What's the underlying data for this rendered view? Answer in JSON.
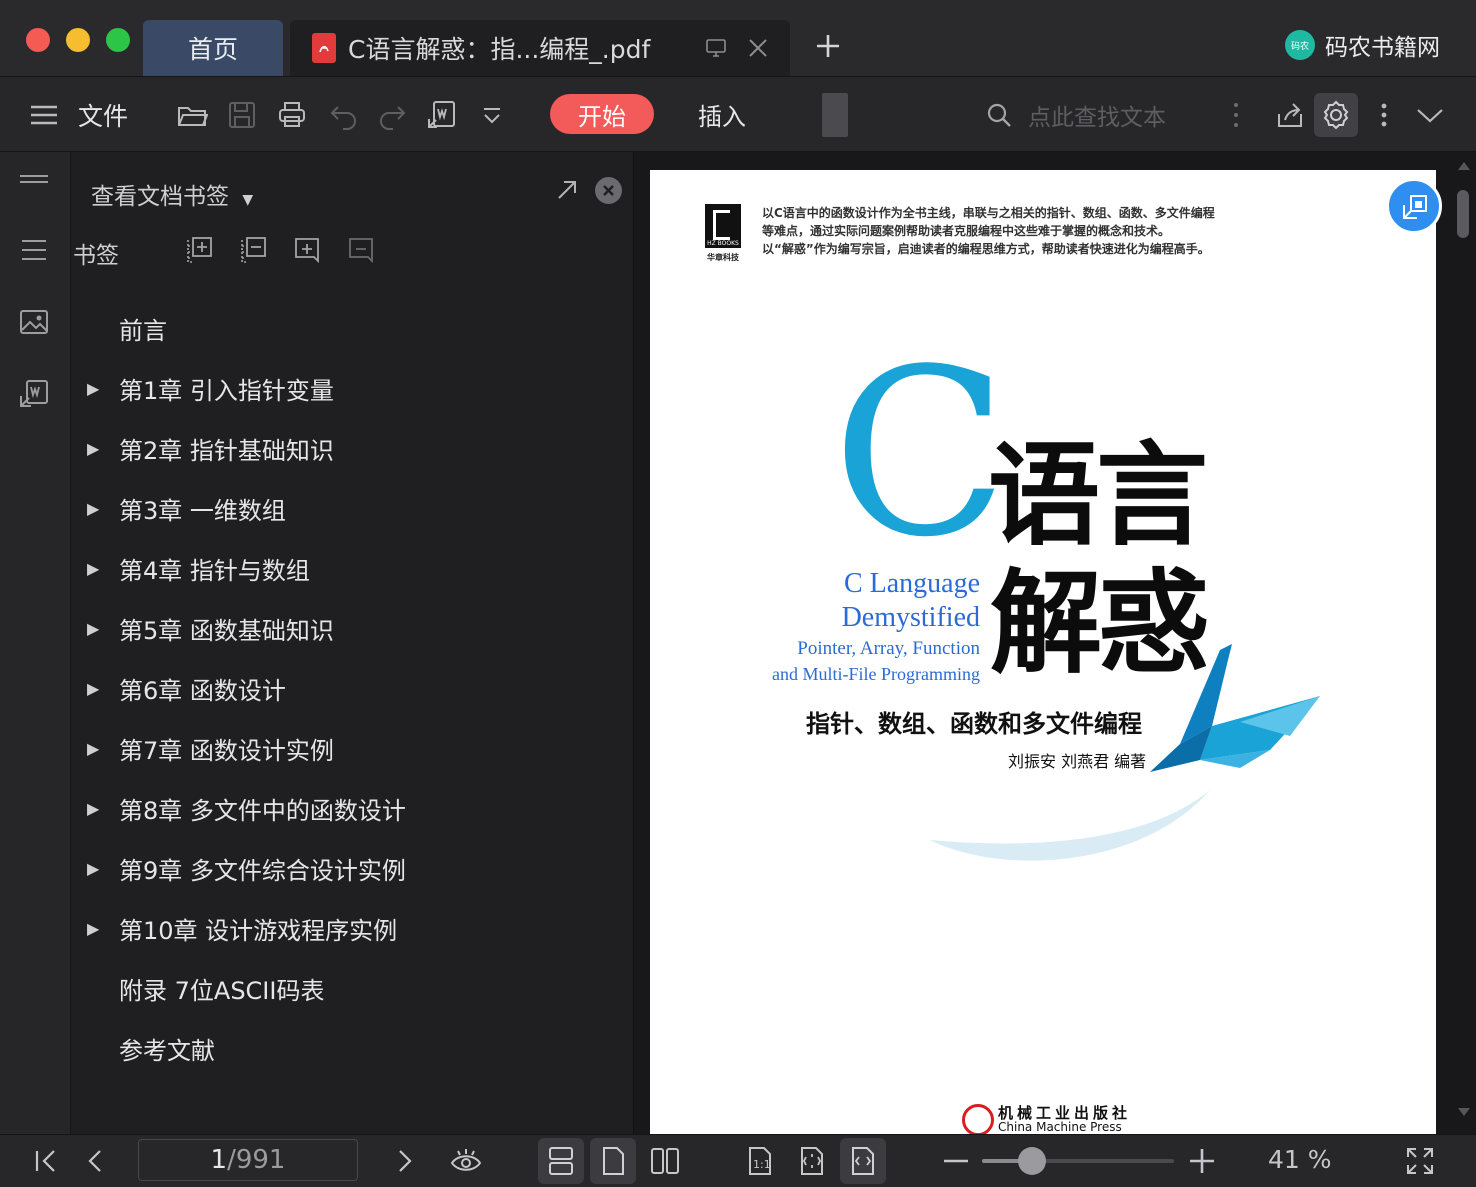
{
  "window": {
    "tabs": [
      {
        "label": "首页"
      },
      {
        "label": "C语言解惑：指...编程_.pdf"
      }
    ],
    "brand": "码农书籍网",
    "brand_logo_text": "码农"
  },
  "toolbar": {
    "menu_label": "文件",
    "start_label": "开始",
    "insert_label": "插入",
    "search_placeholder": "点此查找文本"
  },
  "bookmarks": {
    "panel_title": "查看文档书签",
    "section_label": "书签",
    "items": [
      {
        "label": "前言",
        "expandable": false
      },
      {
        "label": "第1章 引入指针变量",
        "expandable": true
      },
      {
        "label": "第2章 指针基础知识",
        "expandable": true
      },
      {
        "label": "第3章 一维数组",
        "expandable": true
      },
      {
        "label": "第4章 指针与数组",
        "expandable": true
      },
      {
        "label": "第5章 函数基础知识",
        "expandable": true
      },
      {
        "label": "第6章 函数设计",
        "expandable": true
      },
      {
        "label": "第7章 函数设计实例",
        "expandable": true
      },
      {
        "label": "第8章 多文件中的函数设计",
        "expandable": true
      },
      {
        "label": "第9章 多文件综合设计实例",
        "expandable": true
      },
      {
        "label": "第10章 设计游戏程序实例",
        "expandable": true
      },
      {
        "label": "附录 7位ASCII码表",
        "expandable": false
      },
      {
        "label": "参考文献",
        "expandable": false
      }
    ]
  },
  "cover": {
    "blurb_line1": "以C语言中的函数设计作为全书主线，串联与之相关的指针、数组、函数、多文件编程",
    "blurb_line2": "等难点，通过实际问题案例帮助读者克服编程中这些难于掌握的概念和技术。",
    "blurb_line3": "以“解惑”作为编写宗旨，启迪读者的编程思维方式，帮助读者快速进化为编程高手。",
    "publisher_logo_text": "HZ BOOKS",
    "publisher_logo_sub": "华章科技",
    "big_letter": "C",
    "title_line1": "语言",
    "title_line2": "解惑",
    "en_title1": "C Language",
    "en_title2": "Demystified",
    "en_sub1": "Pointer, Array, Function",
    "en_sub2": "and Multi-File Programming",
    "subtitle": "指针、数组、函数和多文件编程",
    "authors": "刘振安 刘燕君 编著",
    "press_cn": "机械工业出版社",
    "press_en": "China Machine Press"
  },
  "status": {
    "current_page": "1",
    "total_pages": "/991",
    "zoom": "41 %",
    "zoom_fraction": 0.26
  },
  "colors": {
    "accent_red": "#f35a5a",
    "cover_cyan": "#1aa3d6",
    "cover_blue": "#2b6bd6",
    "float_button": "#2f8ff0"
  }
}
